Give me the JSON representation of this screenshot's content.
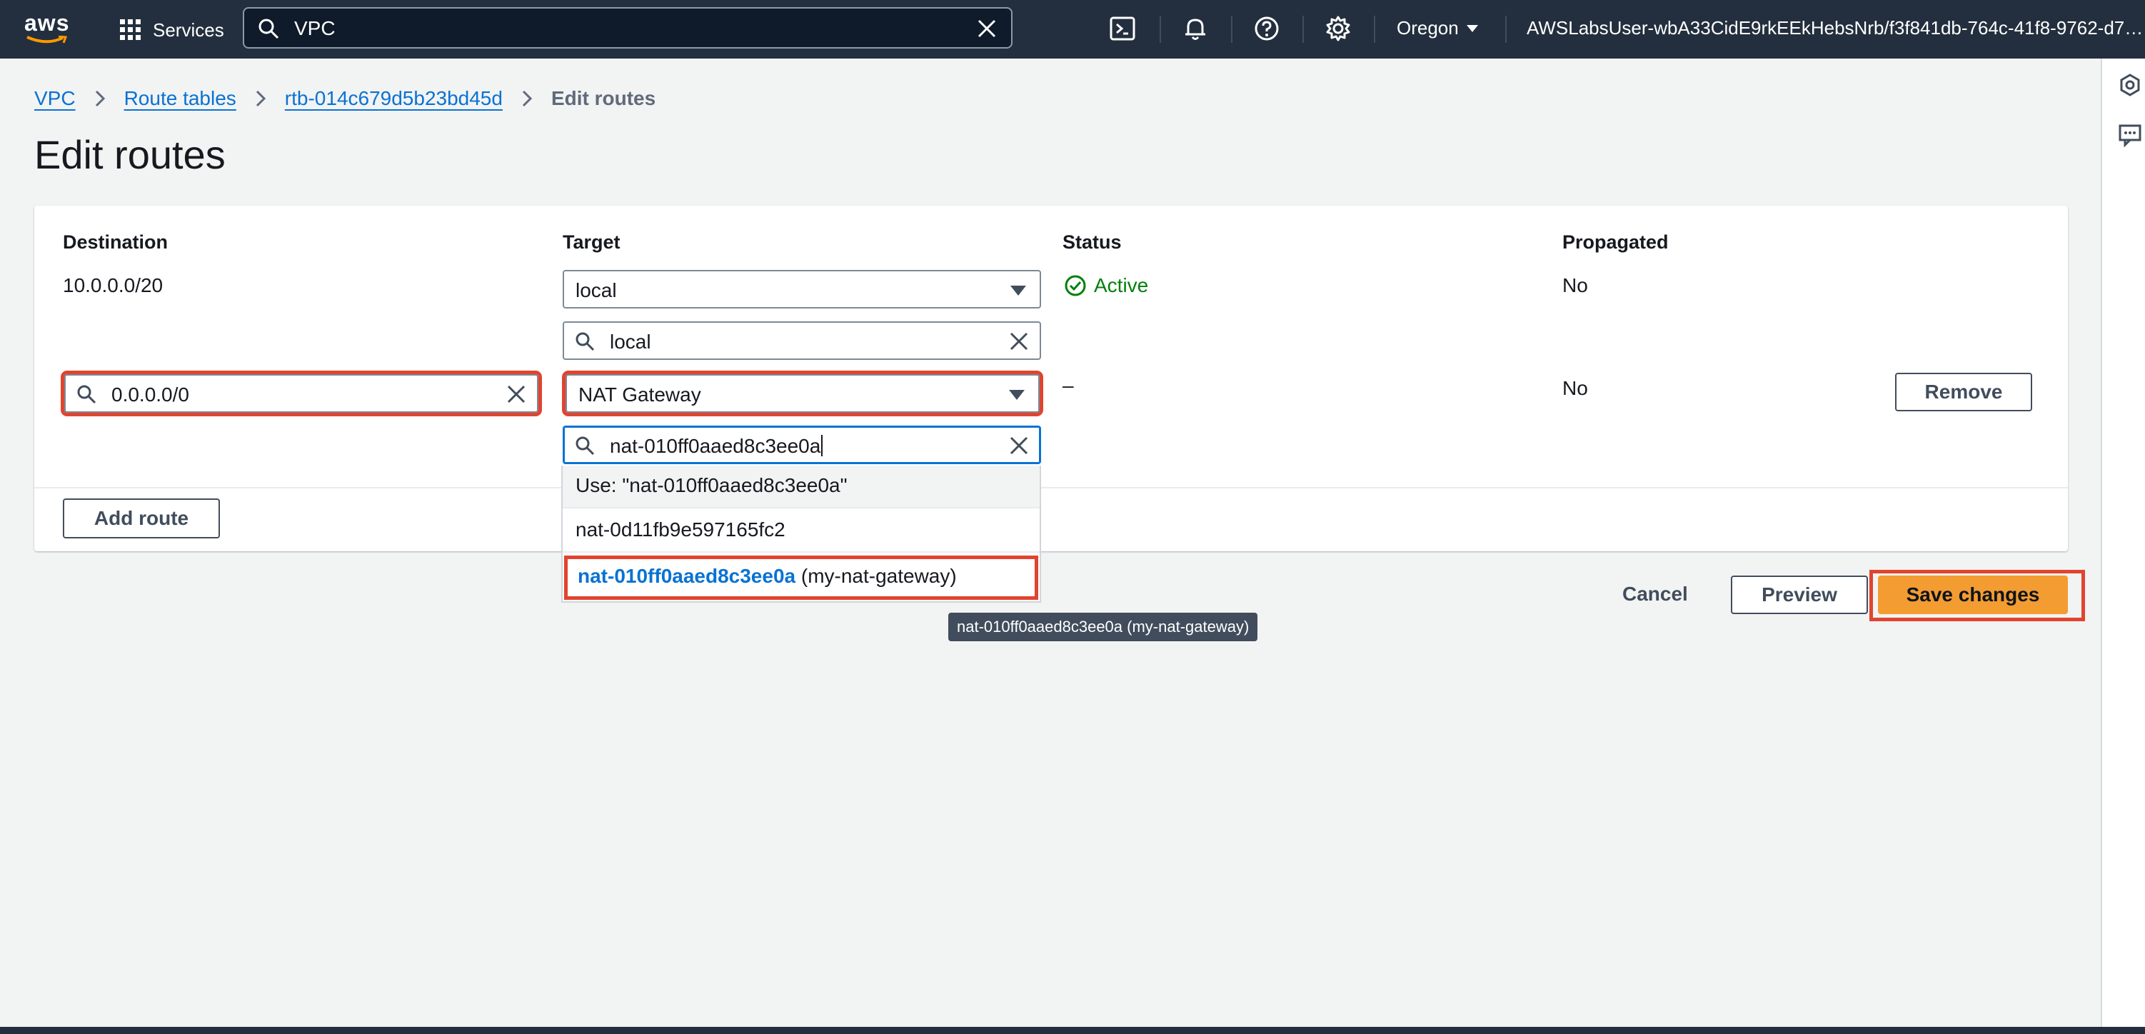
{
  "nav": {
    "logo": "aws",
    "services_label": "Services",
    "search_value": "VPC",
    "region": "Oregon",
    "user": "AWSLabsUser-wbA33CidE9rkEEkHebsNrb/f3f841db-764c-41f8-9762-d7…"
  },
  "breadcrumb": {
    "items": [
      "VPC",
      "Route tables",
      "rtb-014c679d5b23bd45d"
    ],
    "current": "Edit routes"
  },
  "page_title": "Edit routes",
  "table": {
    "headers": {
      "destination": "Destination",
      "target": "Target",
      "status": "Status",
      "propagated": "Propagated"
    },
    "rows": [
      {
        "destination": "10.0.0.0/20",
        "target": "local",
        "target_filter": "local",
        "status": "Active",
        "propagated": "No"
      },
      {
        "destination": "0.0.0.0/0",
        "target": "NAT Gateway",
        "target_filter": "nat-010ff0aaed8c3ee0a",
        "status": "–",
        "propagated": "No",
        "remove_label": "Remove"
      }
    ],
    "add_route_label": "Add route"
  },
  "dropdown": {
    "use_option": "Use: \"nat-010ff0aaed8c3ee0a\"",
    "option_1": "nat-0d11fb9e597165fc2",
    "option_2_id": "nat-010ff0aaed8c3ee0a",
    "option_2_name": " (my-nat-gateway)"
  },
  "tooltip": "nat-010ff0aaed8c3ee0a (my-nat-gateway)",
  "actions": {
    "cancel": "Cancel",
    "preview": "Preview",
    "save": "Save changes"
  },
  "colors": {
    "nav_bg": "#232f3e",
    "link": "#0972d3",
    "primary": "#f39c32",
    "highlight": "#e0442f",
    "success": "#037f0c"
  }
}
